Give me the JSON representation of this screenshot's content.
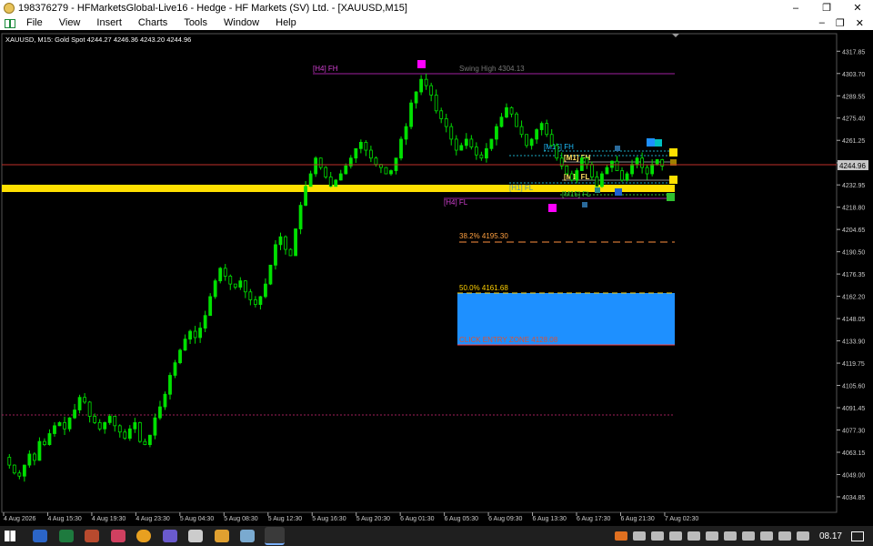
{
  "window": {
    "title": "198376279 - HFMarketsGlobal-Live16 - Hedge - HF Markets (SV) Ltd. - [XAUUSD,M15]",
    "controls": [
      "–",
      "❐",
      "✕"
    ]
  },
  "menu": {
    "items": [
      "File",
      "View",
      "Insert",
      "Charts",
      "Tools",
      "Window",
      "Help"
    ],
    "mdi_controls": [
      "–",
      "❐",
      "✕"
    ]
  },
  "chart": {
    "info_line": "XAUUSD, M15:  Gold Spot  4244.27 4246.36 4243.20 4244.96",
    "current_price_label": "4244.96",
    "colors": {
      "bull": "#00e000",
      "bear": "#00e000",
      "grid": "#202020",
      "axis": "#ffffff",
      "price_line": "#c0302a",
      "zone": "#1e90ff",
      "yellow_band": "#ffe000"
    },
    "annotations": {
      "h4_fh": "[H4] FH",
      "swing_high": "Swing High 4304.13",
      "m15_fh": "[M15] FH",
      "m1_fh": "[M1] FH",
      "m1_fl": "[M1] FL",
      "h1_fl": "[H1] FL",
      "m15_fl": "[M15] FL",
      "h4_fl": "[H4] FL",
      "fib_382": "38.2%  4195.30",
      "fib_500": "50.0%  4161.68",
      "entry_zone": "CLICK ENTRY ZONE  4128.08"
    }
  },
  "chart_data": {
    "type": "candlestick",
    "title": "XAUUSD, M15",
    "y_ticks": [
      "4317.85",
      "4303.70",
      "4289.55",
      "4275.40",
      "4261.25",
      "4246.96",
      "4232.95",
      "4218.80",
      "4204.65",
      "4190.50",
      "4176.35",
      "4162.20",
      "4148.05",
      "4133.90",
      "4119.75",
      "4105.60",
      "4091.45",
      "4077.30",
      "4063.15",
      "4049.00",
      "4034.85"
    ],
    "x_ticks": [
      "4 Aug 2026",
      "4 Aug 15:30",
      "4 Aug 19:30",
      "4 Aug 23:30",
      "5 Aug 04:30",
      "5 Aug 08:30",
      "5 Aug 12:30",
      "5 Aug 16:30",
      "5 Aug 20:30",
      "6 Aug 01:30",
      "6 Aug 05:30",
      "6 Aug 09:30",
      "6 Aug 13:30",
      "6 Aug 17:30",
      "6 Aug 21:30",
      "7 Aug 02:30"
    ],
    "ylim": [
      4025,
      4329
    ],
    "last_price": 4244.96,
    "swing_high": 4304.13,
    "fib_382": 4195.3,
    "fib_500": 4161.68,
    "entry_zone_bottom": 4128.08,
    "close_path": [
      4060,
      4055,
      4050,
      4048,
      4055,
      4062,
      4058,
      4070,
      4068,
      4075,
      4080,
      4082,
      4078,
      4085,
      4090,
      4098,
      4095,
      4086,
      4082,
      4078,
      4082,
      4086,
      4080,
      4076,
      4072,
      4078,
      4082,
      4070,
      4068,
      4074,
      4085,
      4092,
      4100,
      4112,
      4120,
      4128,
      4135,
      4140,
      4136,
      4142,
      4150,
      4162,
      4172,
      4180,
      4175,
      4170,
      4168,
      4172,
      4165,
      4160,
      4157,
      4162,
      4170,
      4182,
      4195,
      4200,
      4192,
      4188,
      4205,
      4220,
      4232,
      4240,
      4250,
      4244,
      4238,
      4232,
      4236,
      4240,
      4245,
      4250,
      4256,
      4260,
      4255,
      4250,
      4246,
      4244,
      4240,
      4242,
      4250,
      4262,
      4270,
      4285,
      4292,
      4300,
      4296,
      4290,
      4280,
      4275,
      4270,
      4262,
      4255,
      4258,
      4262,
      4257,
      4252,
      4250,
      4256,
      4262,
      4270,
      4276,
      4282,
      4278,
      4270,
      4265,
      4258,
      4262,
      4268,
      4272,
      4265,
      4258,
      4250,
      4245,
      4240,
      4236,
      4242,
      4250,
      4246,
      4238,
      4232,
      4240,
      4244,
      4248,
      4242,
      4236,
      4240,
      4246,
      4250,
      4244,
      4240,
      4246,
      4249,
      4244.96
    ]
  }
}
